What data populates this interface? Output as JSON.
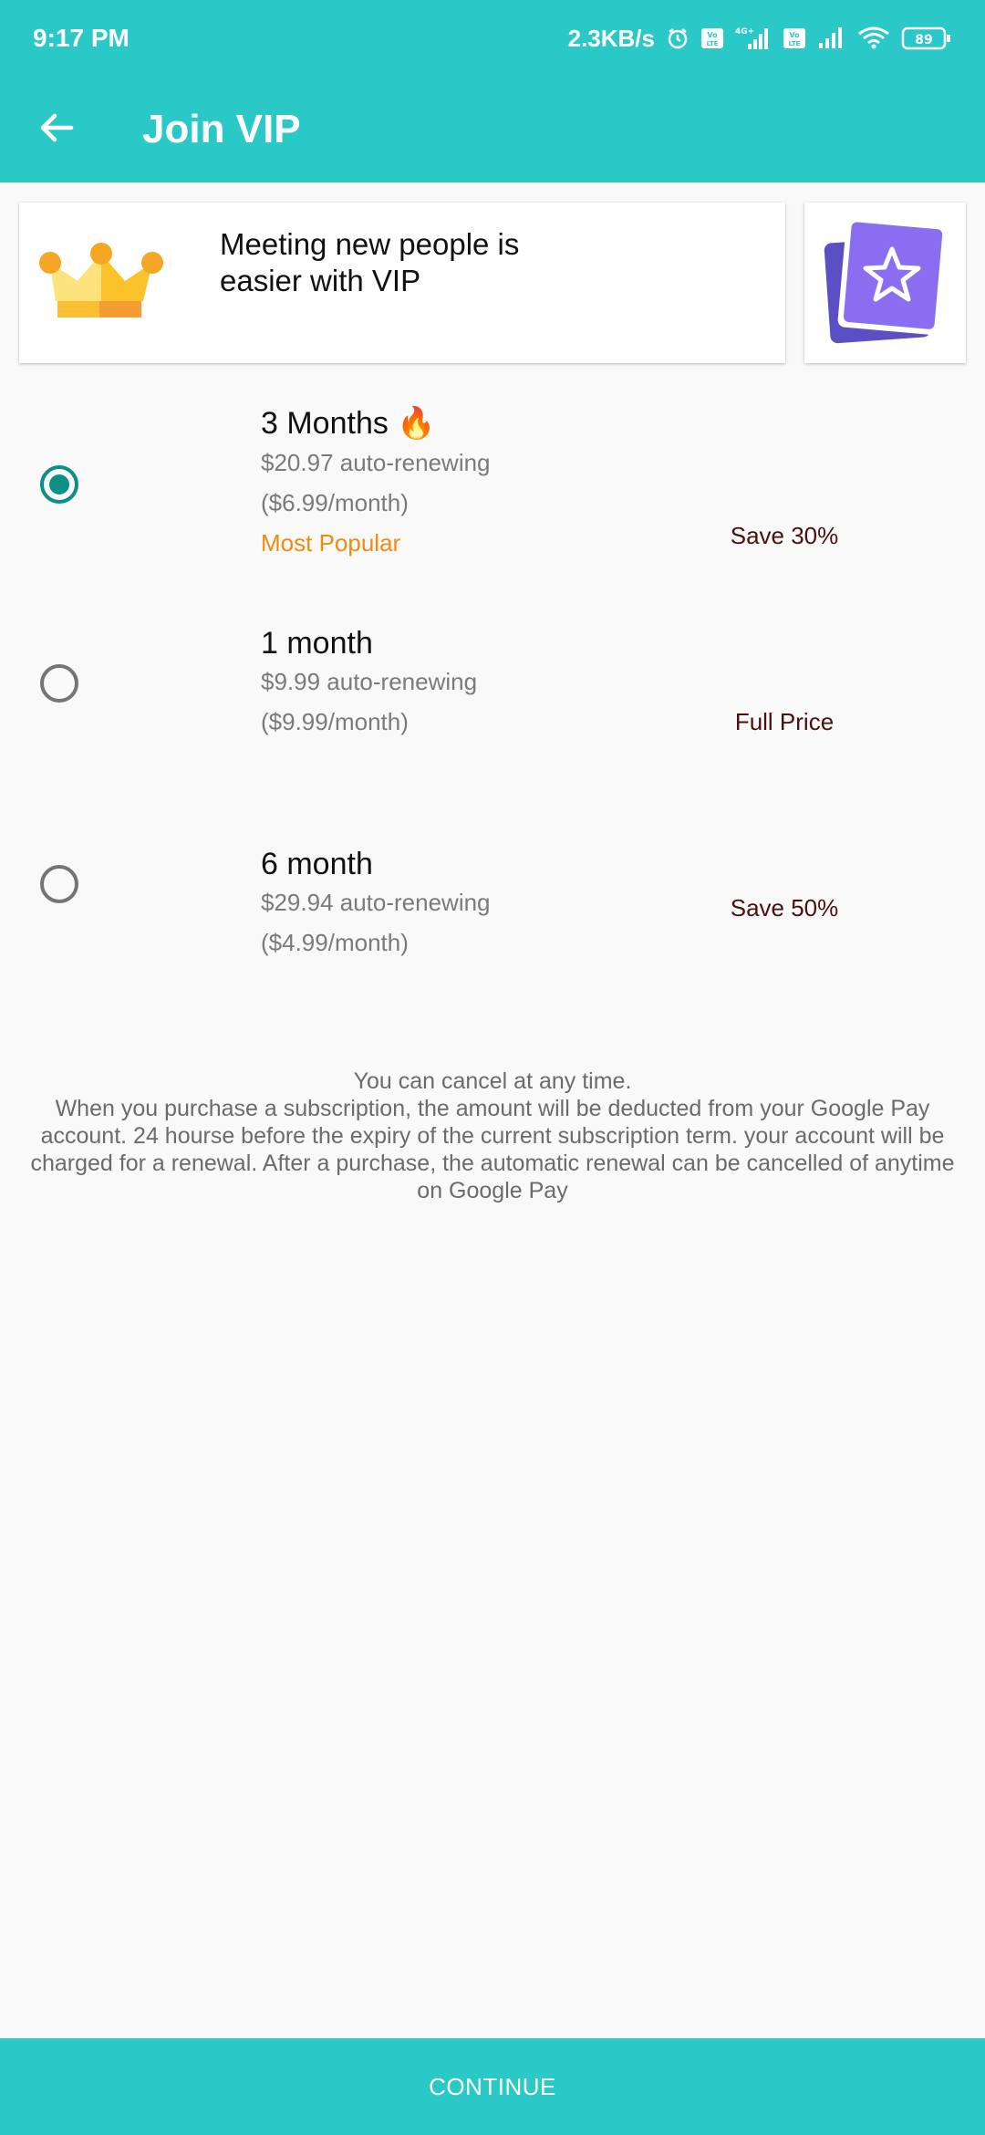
{
  "status_bar": {
    "time": "9:17 PM",
    "network_speed": "2.3KB/s",
    "battery": "89",
    "icons": [
      "alarm-icon",
      "volte-icon",
      "signal-4g-icon",
      "volte-icon",
      "signal-icon",
      "wifi-icon",
      "battery-icon"
    ]
  },
  "header": {
    "title": "Join VIP",
    "back_icon": "arrow-back-icon"
  },
  "banner": {
    "text": "Meeting new people is\n easier with VIP",
    "icon": "crown-icon",
    "side_icon": "star-cards-icon"
  },
  "plans": [
    {
      "title": "3 Months",
      "emoji": "🔥",
      "price": "$20.97 auto-renewing",
      "per_month": "($6.99/month)",
      "tag": "Most Popular",
      "savings": "Save 30%",
      "selected": true
    },
    {
      "title": "1 month",
      "price": "$9.99 auto-renewing",
      "per_month": "($9.99/month)",
      "savings": "Full Price",
      "selected": false
    },
    {
      "title": "6 month",
      "price": "$29.94 auto-renewing",
      "per_month": "($4.99/month)",
      "savings": "Save 50%",
      "selected": false
    }
  ],
  "disclaimer": {
    "line1": "You can cancel at any time.",
    "body": "When you purchase a subscription, the amount will be deducted from your Google Pay account. 24 hourse before the expiry of the current subscription term. your account will be charged for a renewal. After a purchase, the automatic renewal can be cancelled of anytime on Google Pay"
  },
  "continue_label": "CONTINUE",
  "colors": {
    "primary": "#2bc8c8",
    "radio_selected": "#0e8f86",
    "popular": "#ef8b10",
    "savings": "#4a1010"
  }
}
